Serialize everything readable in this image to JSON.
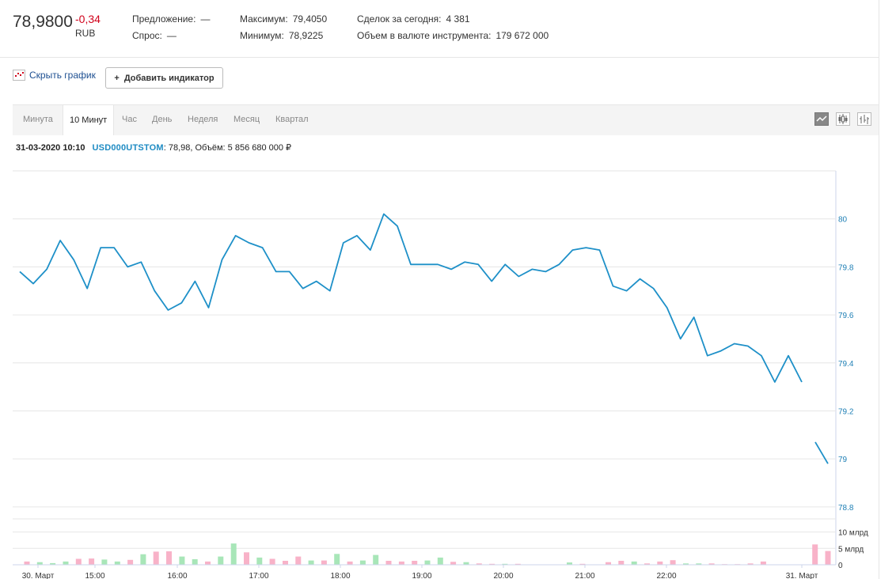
{
  "quote": {
    "price": "78,9800",
    "change": "-0,34",
    "currency": "RUB",
    "offer_label": "Предложение:",
    "offer_value": "—",
    "bid_label": "Спрос:",
    "bid_value": "—",
    "max_label": "Максимум:",
    "max_value": "79,4050",
    "min_label": "Минимум:",
    "min_value": "78,9225",
    "deals_label": "Сделок за сегодня:",
    "deals_value": "4 381",
    "volume_label": "Объем в валюте инструмента:",
    "volume_value": "179 672 000"
  },
  "toolbar": {
    "hide_chart": "Скрыть график",
    "add_indicator": "Добавить индикатор",
    "add_symbol": "+"
  },
  "tabs": [
    "Минута",
    "10 Минут",
    "Час",
    "День",
    "Неделя",
    "Месяц",
    "Квартал"
  ],
  "active_tab": "10 Минут",
  "chart_types": [
    "line-chart-icon",
    "candlestick-icon",
    "ohlc-bars-icon"
  ],
  "info": {
    "datetime": "31-03-2020 10:10",
    "ticker": "USD000UTSTOM",
    "details": ": 78,98, Объём: 5 856 680 000 ₽"
  },
  "colors": {
    "line": "#1e90c8",
    "up_volume": "#a8e6b8",
    "down_volume": "#f8b2c8",
    "change": "#d0021b"
  },
  "chart_data": {
    "type": "line",
    "ylim": [
      78.75,
      80.2
    ],
    "yticks": [
      78.8,
      79,
      79.2,
      79.4,
      79.6,
      79.8,
      80
    ],
    "ytick_labels": [
      "78.8",
      "79",
      "79.2",
      "79.4",
      "79.6",
      "79.8",
      "80"
    ],
    "xtick_labels": [
      "30. Март",
      "15:00",
      "16:00",
      "17:00",
      "18:00",
      "19:00",
      "20:00",
      "21:00",
      "22:00",
      "31. Март"
    ],
    "series": [
      {
        "values": [
          79.78,
          79.73,
          79.79,
          79.91,
          79.83,
          79.71,
          79.88,
          79.88,
          79.8,
          79.82,
          79.7,
          79.62,
          79.65,
          79.74,
          79.63,
          79.83,
          79.93,
          79.9,
          79.88,
          79.78,
          79.78,
          79.71,
          79.74,
          79.7,
          79.9,
          79.93,
          79.87,
          80.02,
          79.97,
          79.81,
          79.81,
          79.81,
          79.79,
          79.82,
          79.81,
          79.74,
          79.81,
          79.76,
          79.79,
          79.78,
          79.81,
          79.87,
          79.88,
          79.87,
          79.72,
          79.7,
          79.75,
          79.71,
          79.63,
          79.5,
          79.59,
          79.43,
          79.45,
          79.48,
          79.47,
          79.43,
          79.32,
          79.43,
          79.32
        ]
      },
      {
        "values": [
          79.07,
          78.98
        ]
      }
    ],
    "volume": {
      "ylim": [
        0,
        14
      ],
      "yticks": [
        0,
        5,
        10
      ],
      "ytick_labels": [
        "0",
        "5 млрд",
        "10 млрд"
      ],
      "values": [
        1.0,
        0.8,
        0.5,
        1.0,
        1.8,
        1.9,
        1.6,
        1.0,
        1.5,
        3.2,
        4.0,
        4.1,
        2.5,
        1.7,
        1.0,
        2.5,
        6.5,
        3.8,
        2.2,
        1.8,
        1.2,
        2.5,
        1.3,
        1.3,
        3.3,
        1.0,
        1.3,
        3.0,
        1.2,
        1.0,
        1.2,
        1.3,
        2.2,
        0.9,
        0.8,
        0.4,
        0.3,
        0.3,
        0.3,
        0.0,
        0.0,
        0.0,
        0.7,
        0.3,
        0.0,
        0.8,
        1.2,
        1.0,
        0.4,
        1.0,
        1.4,
        0.4,
        0.4,
        0.4,
        0.2,
        0.2,
        0.4,
        1.0,
        0.0,
        0.0,
        0.0,
        6.2,
        4.2
      ],
      "direction": [
        "d",
        "u",
        "u",
        "u",
        "d",
        "d",
        "u",
        "u",
        "d",
        "u",
        "d",
        "d",
        "u",
        "u",
        "d",
        "u",
        "u",
        "d",
        "u",
        "d",
        "d",
        "d",
        "u",
        "d",
        "u",
        "d",
        "u",
        "u",
        "d",
        "d",
        "d",
        "u",
        "u",
        "d",
        "u",
        "d",
        "d",
        "u",
        "d",
        "d",
        "d",
        "d",
        "u",
        "d",
        "d",
        "d",
        "d",
        "u",
        "d",
        "d",
        "d",
        "u",
        "u",
        "d",
        "d",
        "d",
        "d",
        "d",
        "d",
        "d",
        "d",
        "d",
        "d"
      ]
    }
  }
}
